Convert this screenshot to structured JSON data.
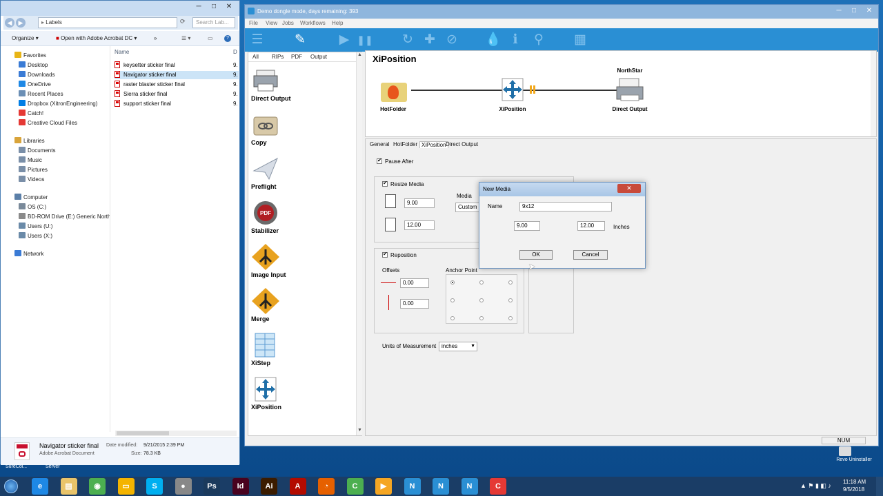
{
  "explorer": {
    "title": "Labels",
    "search_placeholder": "Search Lab...",
    "toolbar": {
      "organize": "Organize",
      "open_with": "Open with Adobe Acrobat DC",
      "more": "»"
    },
    "nav": [
      {
        "label": "Favorites",
        "type": "header",
        "icon": "star-icon"
      },
      {
        "label": "Desktop",
        "type": "item",
        "icon": "desktop-icon"
      },
      {
        "label": "Downloads",
        "type": "item",
        "icon": "downloads-icon"
      },
      {
        "label": "OneDrive",
        "type": "item",
        "icon": "cloud-icon"
      },
      {
        "label": "Recent Places",
        "type": "item",
        "icon": "recent-icon"
      },
      {
        "label": "Dropbox (XitronEngineering)",
        "type": "item",
        "icon": "dropbox-icon"
      },
      {
        "label": "Catch!",
        "type": "item",
        "icon": "catch-icon"
      },
      {
        "label": "Creative Cloud Files",
        "type": "item",
        "icon": "creative-cloud-icon"
      },
      {
        "label": "Libraries",
        "type": "header",
        "icon": "library-icon"
      },
      {
        "label": "Documents",
        "type": "item",
        "icon": "documents-icon"
      },
      {
        "label": "Music",
        "type": "item",
        "icon": "music-icon"
      },
      {
        "label": "Pictures",
        "type": "item",
        "icon": "pictures-icon"
      },
      {
        "label": "Videos",
        "type": "item",
        "icon": "videos-icon"
      },
      {
        "label": "Computer",
        "type": "header",
        "icon": "computer-icon"
      },
      {
        "label": "OS (C:)",
        "type": "item",
        "icon": "drive-icon"
      },
      {
        "label": "BD-ROM Drive (E:) Generic North",
        "type": "item",
        "icon": "disc-icon"
      },
      {
        "label": "Users (U:)",
        "type": "item",
        "icon": "network-drive-icon"
      },
      {
        "label": "Users (X:)",
        "type": "item",
        "icon": "network-drive-icon"
      },
      {
        "label": "Network",
        "type": "header",
        "icon": "network-icon"
      }
    ],
    "column_name": "Name",
    "column_d": "D",
    "files": [
      {
        "name": "keysetter sticker final",
        "size": "9."
      },
      {
        "name": "Navigator sticker final",
        "size": "9."
      },
      {
        "name": "raster blaster sticker final",
        "size": "9."
      },
      {
        "name": "Sierra sticker final",
        "size": "9."
      },
      {
        "name": "support sticker final",
        "size": "9."
      }
    ],
    "details": {
      "name": "Navigator sticker final",
      "type": "Adobe Acrobat Document",
      "modified_label": "Date modified:",
      "modified": "9/21/2015 2:39 PM",
      "size_label": "Size:",
      "size": "78.3 KB"
    }
  },
  "app": {
    "title": "Demo dongle mode, days remaining: 393",
    "menu": [
      "File",
      "View",
      "Jobs",
      "Workflows",
      "Help"
    ],
    "toolbar_icons": [
      "menu-icon",
      "pencil-icon",
      "play-icon",
      "pause-icon",
      "refresh-icon",
      "plus-icon",
      "block-icon",
      "drops-icon",
      "info-icon",
      "search-icon",
      "briefcase-icon"
    ],
    "palette_tabs": [
      "All",
      "RIPs",
      "PDF",
      "Output"
    ],
    "palette": [
      {
        "label": "Direct Output",
        "icon": "printer-icon"
      },
      {
        "label": "Copy",
        "icon": "copy-icon"
      },
      {
        "label": "Preflight",
        "icon": "paper-plane-icon"
      },
      {
        "label": "Stabilizer",
        "icon": "pdf-gear-icon"
      },
      {
        "label": "Image Input",
        "icon": "merge-arrow-icon"
      },
      {
        "label": "Merge",
        "icon": "merge-arrow-icon"
      },
      {
        "label": "XiStep",
        "icon": "step-grid-icon"
      },
      {
        "label": "XiPosition",
        "icon": "move-arrows-icon"
      }
    ],
    "flow": {
      "title": "XiPosition",
      "nodes": [
        {
          "label": "HotFolder",
          "top_label": ""
        },
        {
          "label": "XiPosition",
          "top_label": ""
        },
        {
          "label": "Direct Output",
          "top_label": "NorthStar"
        }
      ]
    },
    "tabs": [
      "General",
      "HotFolder",
      "XiPosition",
      "Direct Output"
    ],
    "props": {
      "pause_after": "Pause After",
      "resize_media": "Resize Media",
      "width": "9.00",
      "height": "12.00",
      "media_label": "Media",
      "media_value": "Custom",
      "reposition": "Reposition",
      "offsets": "Offsets",
      "anchor_point": "Anchor Point",
      "offset_x": "0.00",
      "offset_y": "0.00",
      "units_label": "Units of Measurement",
      "units_value": "inches"
    },
    "status": {
      "num": "NUM"
    }
  },
  "dialog": {
    "title": "New Media",
    "name_label": "Name",
    "name_value": "9x12",
    "width": "9.00",
    "height": "12.00",
    "units": "Inches",
    "ok": "OK",
    "cancel": "Cancel"
  },
  "desktop_labels": {
    "sure": "SureCol...",
    "server": "Server",
    "revo": "Revo Uninstaller"
  },
  "taskbar": {
    "time": "11:18 AM",
    "date": "9/5/2018",
    "apps": [
      "ie-icon",
      "explorer-icon",
      "chrome-icon",
      "folder-icon",
      "skype-icon",
      "app-icon",
      "photoshop-icon",
      "indesign-icon",
      "illustrator-icon",
      "acrobat-icon",
      "firefox-icon",
      "camtasia-icon",
      "media-icon",
      "northstar-icon",
      "northstar-icon",
      "northstar-icon",
      "camtasia-red-icon"
    ]
  },
  "colors": {
    "accent": "#2a8fd4",
    "flame": "#e8551c",
    "arrow": "#f2a81c"
  }
}
